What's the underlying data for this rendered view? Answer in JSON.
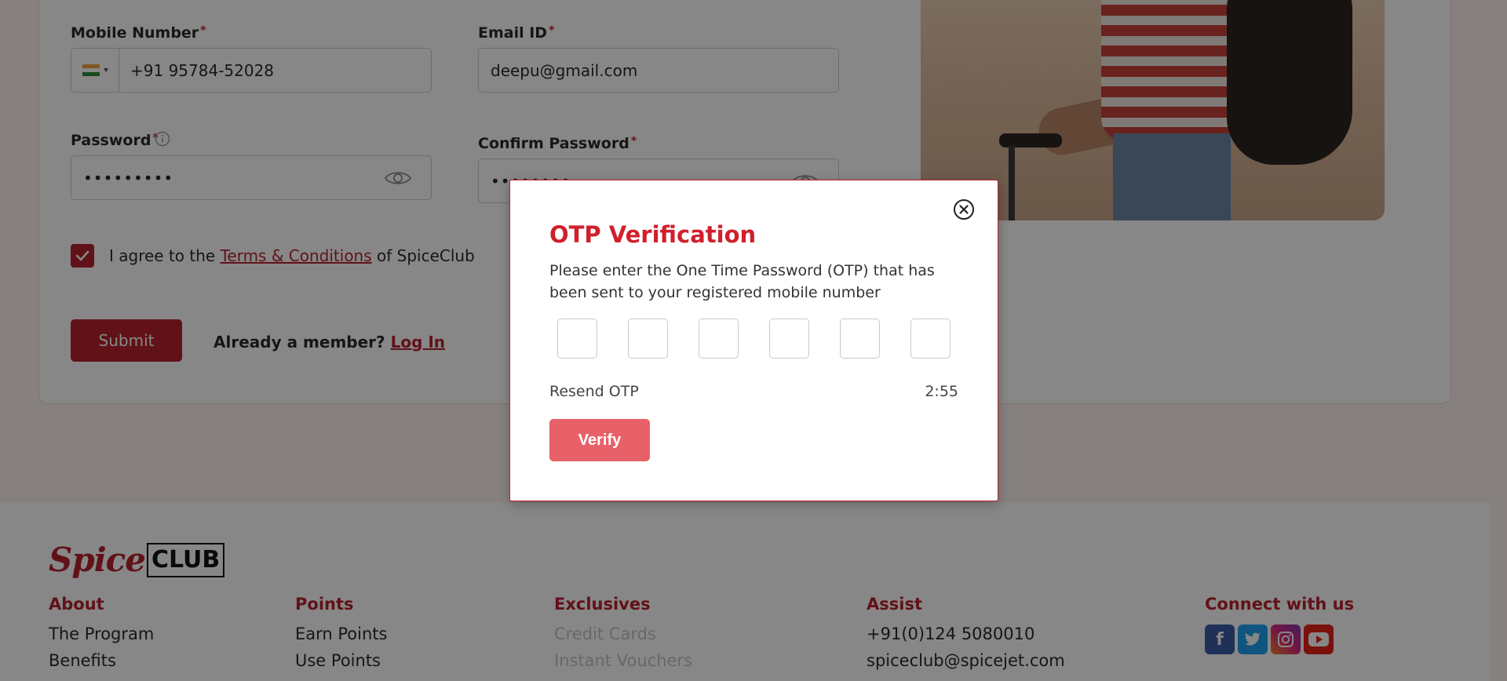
{
  "form": {
    "mobile_label": "Mobile Number",
    "mobile_value": "+91 95784-52028",
    "email_label": "Email ID",
    "email_value": "deepu@gmail.com",
    "password_label": "Password",
    "password_value": "•••••••••",
    "confirm_password_label": "Confirm Password",
    "confirm_password_value": "••••••••",
    "required_marker": "*",
    "agree_prefix": "I agree to the",
    "terms_link": "Terms & Conditions",
    "agree_suffix": "of SpiceClub",
    "agree_checked": true,
    "submit_label": "Submit",
    "member_text": "Already a member?",
    "login_link": "Log In"
  },
  "modal": {
    "title": "OTP Verification",
    "description": "Please enter the One Time Password (OTP) that has been sent to your registered mobile number",
    "otp_digits": [
      "",
      "",
      "",
      "",
      "",
      ""
    ],
    "resend_label": "Resend OTP",
    "timer": "2:55",
    "verify_label": "Verify"
  },
  "footer": {
    "logo_spice": "Spice",
    "logo_club": "CLUB",
    "columns": [
      {
        "heading": "About",
        "links": [
          "The Program",
          "Benefits"
        ]
      },
      {
        "heading": "Points",
        "links": [
          "Earn Points",
          "Use Points"
        ]
      },
      {
        "heading": "Exclusives",
        "links": [
          "Credit Cards",
          "Instant Vouchers"
        ]
      },
      {
        "heading": "Assist",
        "links": [
          "+91(0)124 5080010",
          "spiceclub@spicejet.com"
        ]
      }
    ],
    "connect_heading": "Connect with us",
    "social": [
      "facebook-icon",
      "twitter-icon",
      "instagram-icon",
      "youtube-icon"
    ]
  },
  "colors": {
    "brand_red": "#b8232e",
    "title_red": "#d11f2c",
    "verify_button": "#e86169"
  }
}
